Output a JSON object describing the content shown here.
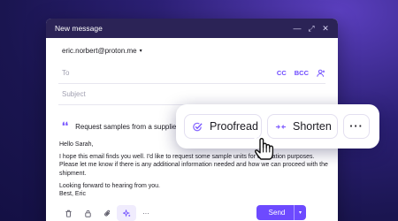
{
  "window": {
    "title": "New message",
    "controls": [
      "minimize-icon",
      "expand-icon",
      "close-icon"
    ]
  },
  "from": {
    "address": "eric.norbert@proton.me",
    "caret": "▾"
  },
  "to": {
    "label": "To",
    "cc": "CC",
    "bcc": "BCC",
    "icon": "add-contact-icon"
  },
  "subject": {
    "placeholder": "Subject"
  },
  "assistant": {
    "icon": "quote-icon",
    "prompt": "Request samples from a supplier"
  },
  "body": {
    "greeting": "Hello Sarah,",
    "paragraph": "I hope this email finds you well. I'd like to request some sample units for evaluation purposes. Please let me know if there is any additional information needed and how we can proceed with the shipment.",
    "closing_line": "Looking forward to hearing from you.",
    "signoff": "Best, Eric"
  },
  "toolbar": {
    "icons": [
      "trash-icon",
      "lock-icon",
      "attachment-icon",
      "sparkle-icon",
      "more-icon"
    ],
    "more_label": "···",
    "send_label": "Send",
    "send_caret": "▾"
  },
  "popover": {
    "proofread_label": "Proofread",
    "shorten_label": "Shorten",
    "more_label": "···"
  },
  "colors": {
    "accent": "#6d4aff",
    "titlebar": "#2b2356",
    "background": "#1a1550"
  }
}
